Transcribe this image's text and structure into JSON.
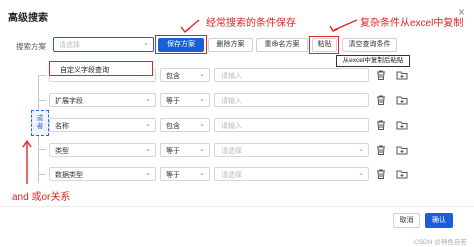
{
  "dialog": {
    "title": "高级搜索",
    "close_icon": "×"
  },
  "scheme": {
    "label": "搜索方案",
    "placeholder": "请选择"
  },
  "toolbar": {
    "save": "保存方案",
    "delete": "删除方案",
    "rename": "重命名方案",
    "paste": "粘贴",
    "clear": "清空查询条件"
  },
  "tooltip": "从excel中复制后粘贴",
  "dropdown_item": "自定义字段查询",
  "conjunction": "或者",
  "rows": [
    {
      "field": "",
      "op": "包含",
      "value": "请输入"
    },
    {
      "field": "扩展字段",
      "op": "等于",
      "value": "请输入"
    },
    {
      "field": "名称",
      "op": "包含",
      "value": "请输入"
    },
    {
      "field": "类型",
      "op": "等于",
      "value": "请选择"
    },
    {
      "field": "数据类型",
      "op": "等于",
      "value": "请选择"
    }
  ],
  "footer": {
    "cancel": "取消",
    "confirm": "确认"
  },
  "annotations": {
    "save_note": "经常搜索的条件保存",
    "paste_note": "复杂条件从excel中复制",
    "and_or_note": "and 或or关系"
  },
  "watermark": "CSDN @神色自若",
  "colors": {
    "primary": "#1a5fd8",
    "annotation": "#e52323"
  }
}
